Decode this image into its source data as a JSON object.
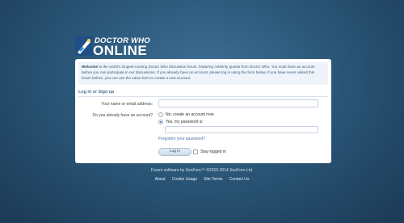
{
  "header": {
    "logo_line1": "DOCTOR WHO",
    "logo_line2": "ONLINE"
  },
  "welcome": {
    "lead": "Welcome",
    "body": " to the world's longest-running Doctor Who discussion forum, featuring celebrity guests from Doctor Who. You must have an account before you can participate in our discussions. If you already have an account, please log in using the form below. If you have never visited this forum before, you can use the same form to create a new account."
  },
  "login": {
    "section_title": "Log in or Sign up",
    "name_label": "Your name or email address:",
    "name_value": "",
    "account_question": "Do you already have an account?",
    "option_no": "No, create an account now.",
    "option_yes": "Yes, my password is:",
    "password_value": "",
    "forgot_link": "Forgotten your password?",
    "login_button": "Log in",
    "stay_logged_in": "Stay logged in"
  },
  "footer": {
    "credit": "Forum software by XenForo™ ©2010-2014 XenForo Ltd.",
    "links": [
      "About",
      "Cookie Usage",
      "Site Terms",
      "Contact Us"
    ]
  }
}
